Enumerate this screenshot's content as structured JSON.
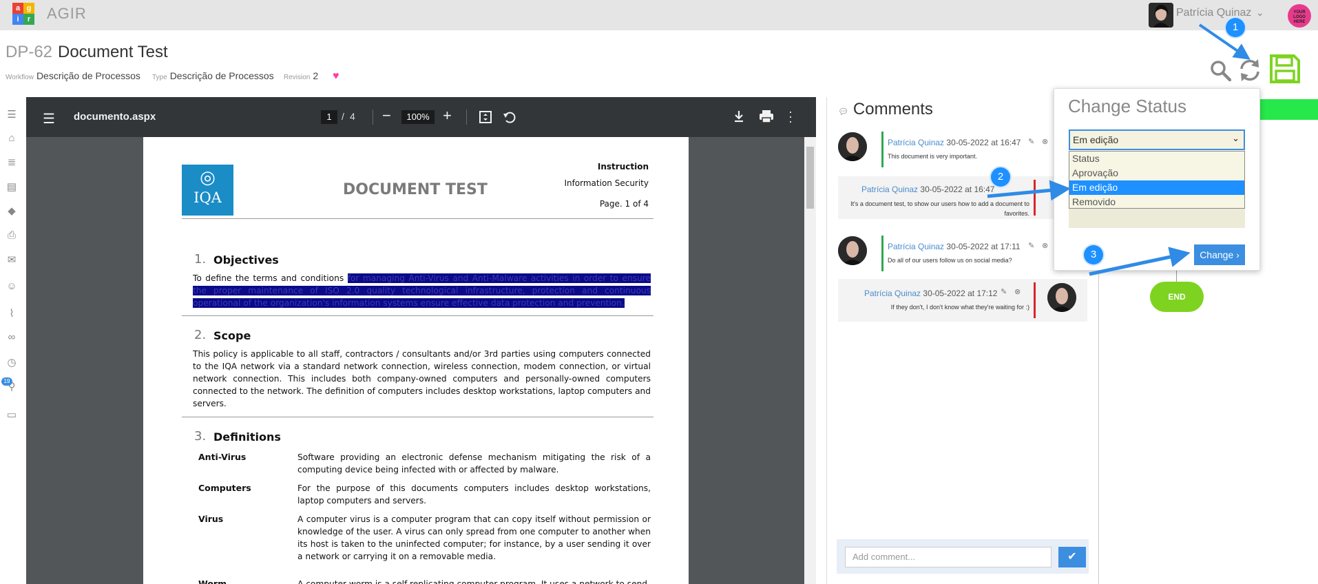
{
  "app": {
    "name": "AGIR",
    "logo_letters": [
      "a",
      "g",
      "i",
      "r"
    ]
  },
  "user": {
    "name": "Patrícia Quinaz",
    "brand_logo": "YOUR LOGO HERE"
  },
  "document": {
    "code": "DP-62",
    "title": "Document Test",
    "workflow_label": "Workflow",
    "workflow_value": "Descrição de Processos",
    "type_label": "Type",
    "type_value": "Descrição de Processos",
    "revision_label": "Revision",
    "revision_value": "2"
  },
  "actions": [
    "search-icon",
    "refresh-icon",
    "save-icon"
  ],
  "sidebar_icons": [
    "menu-icon",
    "home-icon",
    "list-icon",
    "document-icon",
    "tag-icon",
    "print-icon",
    "mail-icon",
    "users-icon",
    "attachment-icon",
    "link-icon",
    "clock-icon",
    "workflow-icon",
    "archive-icon"
  ],
  "sidebar_badge": "19",
  "viewer": {
    "filename": "documento.aspx",
    "page_current": "1",
    "page_sep": "/",
    "page_total": "4",
    "zoom": "100%"
  },
  "pdf": {
    "logo_text": "IQA",
    "heading": "DOCUMENT TEST",
    "header_right": [
      "Instruction",
      "Information Security",
      "Page. 1 of 4"
    ],
    "sections": [
      {
        "num": "1.",
        "title": "Objectives",
        "text_plain": "To define the terms and conditions ",
        "text_highlight": "for managing Anti-Virus and Anti-Malware activities in order to ensure the proper maintenance of ISO 2.0 quality technological infrastructure, protection and continuous operational of the organization's information systems ensure effective data protection and prevention."
      },
      {
        "num": "2.",
        "title": "Scope",
        "text": "This policy is applicable to all staff, contractors / consultants and/or 3rd parties using computers connected to the IQA network via a standard network connection, wireless connection, modem connection, or virtual network connection. This includes both company-owned computers and personally-owned computers connected to the network. The definition of computers includes desktop workstations, laptop computers and servers."
      },
      {
        "num": "3.",
        "title": "Definitions"
      }
    ],
    "definitions": [
      {
        "term": "Anti-Virus",
        "text": "Software providing an electronic defense mechanism mitigating the risk of a computing device being infected with or affected by malware."
      },
      {
        "term": "Computers",
        "text": "For the purpose of this documents computers includes desktop workstations, laptop computers and servers."
      },
      {
        "term": "Virus",
        "text": "A computer virus is a computer program that can copy itself without permission or knowledge of the user. A virus can only spread from one computer to another when its host is taken to the uninfected computer; for instance, by a user sending it over a network or carrying it on a removable media."
      },
      {
        "term": "Worm",
        "text": "A computer worm is a self-replicating computer program. It uses a network to send"
      }
    ]
  },
  "comments": {
    "header": "Comments",
    "items": [
      {
        "author": "Patrícia Quinaz",
        "date": "30-05-2022 at 16:47",
        "text": "This document is very important.",
        "flag": "#2fa84f"
      },
      {
        "author": "Patrícia Quinaz",
        "date": "30-05-2022 at 16:47",
        "text": "It's a document test, to show our users how to add a document to favorites.",
        "flag": "#d9262b"
      },
      {
        "author": "Patrícia Quinaz",
        "date": "30-05-2022 at 17:11",
        "text": "Do all of our users follow us on social media?",
        "flag": "#2fa84f"
      },
      {
        "author": "Patrícia Quinaz",
        "date": "30-05-2022 at 17:12",
        "text": "If they don't, I don't know what they're waiting for :)",
        "flag": "#d9262b"
      }
    ],
    "input_placeholder": "Add comment..."
  },
  "change_status": {
    "title": "Change Status",
    "selected": "Em edição",
    "options": [
      "Status",
      "Aprovação",
      "Em edição",
      "Removido"
    ],
    "button": "Change"
  },
  "workflow": {
    "end_label": "END"
  },
  "annotations": [
    "1",
    "2",
    "3"
  ],
  "colors": {
    "accent": "#3b8ee0",
    "save": "#7ed321",
    "heart": "#ff3e9a",
    "bar": "#27e84a"
  }
}
